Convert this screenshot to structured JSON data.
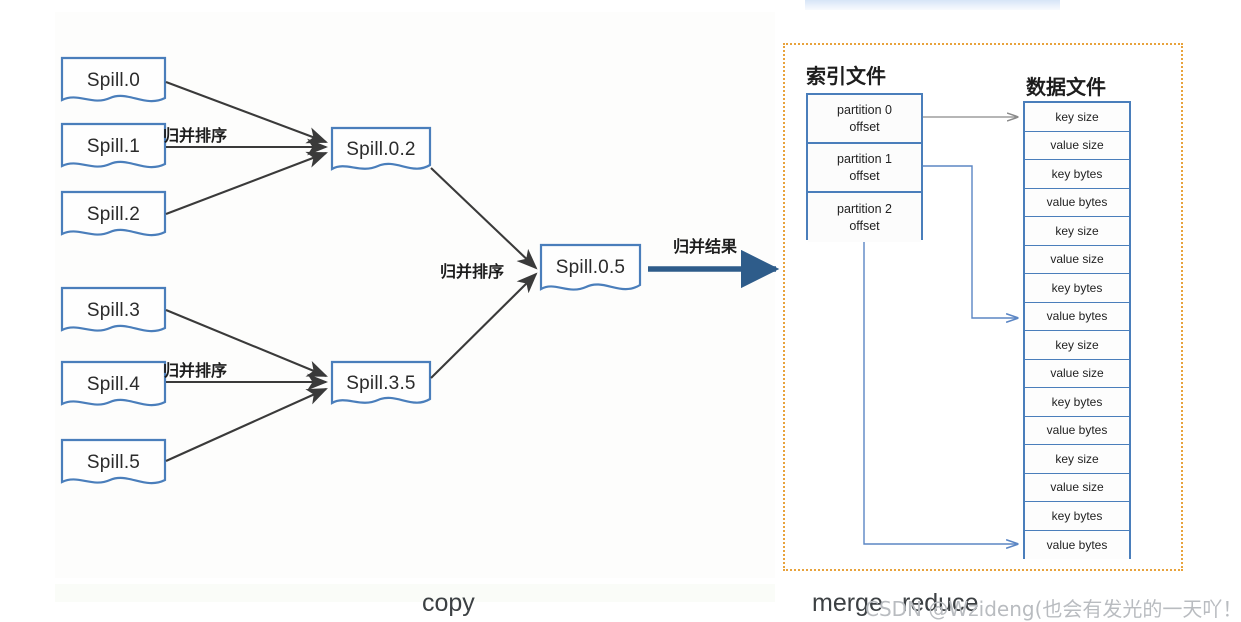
{
  "diagram": {
    "title_hidden": "",
    "spills_top": [
      {
        "label": "Spill.0"
      },
      {
        "label": "Spill.1"
      },
      {
        "label": "Spill.2"
      }
    ],
    "spills_bottom": [
      {
        "label": "Spill.3"
      },
      {
        "label": "Spill.4"
      },
      {
        "label": "Spill.5"
      }
    ],
    "merge_stage1": [
      {
        "label": "Spill.0.2"
      },
      {
        "label": "Spill.3.5"
      }
    ],
    "merge_final": {
      "label": "Spill.0.5"
    },
    "edge_labels": {
      "merge_sort_top": "归并排序",
      "merge_sort_bottom": "归并排序",
      "merge_sort_final": "归并排序",
      "merge_result": "归并结果"
    }
  },
  "merge_region": {
    "index_file_title": "索引文件",
    "data_file_title": "数据文件",
    "index_rows": [
      {
        "line1": "partition 0",
        "line2": "offset"
      },
      {
        "line1": "partition 1",
        "line2": "offset"
      },
      {
        "line1": "partition 2",
        "line2": "offset"
      }
    ],
    "data_rows": [
      {
        "label": "key size"
      },
      {
        "label": "value size"
      },
      {
        "label": "key bytes"
      },
      {
        "label": "value bytes"
      },
      {
        "label": "key size"
      },
      {
        "label": "value size"
      },
      {
        "label": "key bytes"
      },
      {
        "label": "value bytes"
      },
      {
        "label": "key size"
      },
      {
        "label": "value size"
      },
      {
        "label": "key bytes"
      },
      {
        "label": "value bytes"
      },
      {
        "label": "key size"
      },
      {
        "label": "value size"
      },
      {
        "label": "key bytes"
      },
      {
        "label": "value bytes"
      }
    ]
  },
  "captions": {
    "copy": "copy",
    "merge": "merge",
    "reduce": "reduce",
    "watermark": "CSDN @Wzideng(也会有发光的一天吖！)"
  },
  "colors": {
    "box_border": "#4a7ebb",
    "region_border": "#e8a33d",
    "arrow_dark": "#3a3a3a",
    "arrow_blue": "#2e5c8a",
    "connector_blue": "#5b86c4",
    "connector_gray": "#8a8a8a"
  }
}
